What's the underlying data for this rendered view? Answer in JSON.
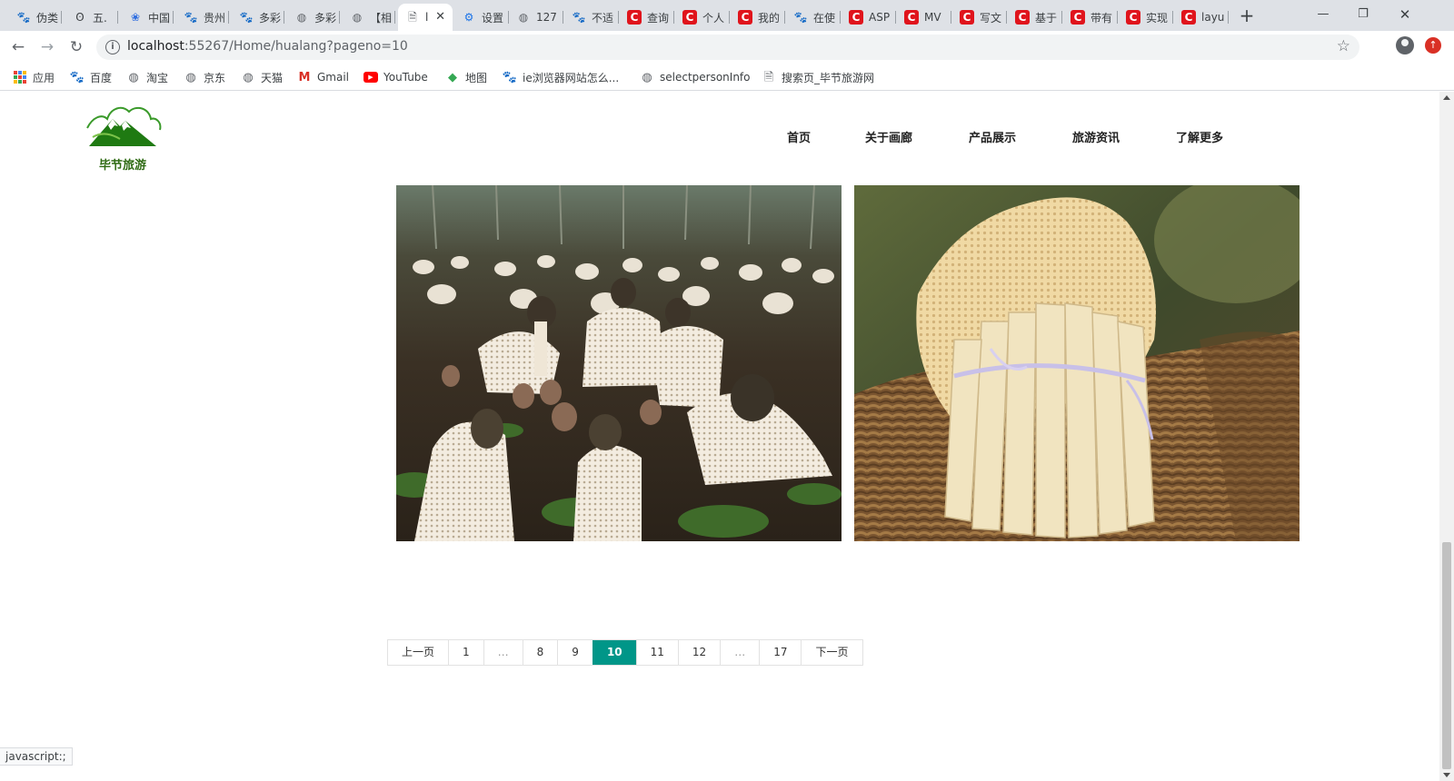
{
  "browser": {
    "tabs": [
      {
        "title": "伪类",
        "favicon": "paw-icon"
      },
      {
        "title": "五.",
        "favicon": "fan-icon"
      },
      {
        "title": "中国",
        "favicon": "paw-outline-icon"
      },
      {
        "title": "贵州",
        "favicon": "paw-icon"
      },
      {
        "title": "多彩",
        "favicon": "paw-icon"
      },
      {
        "title": "多彩",
        "favicon": "globe-icon"
      },
      {
        "title": "【相",
        "favicon": "globe-icon"
      },
      {
        "title": "l",
        "favicon": "page-icon",
        "active": true
      },
      {
        "title": "设置",
        "favicon": "gear-icon"
      },
      {
        "title": "127",
        "favicon": "globe-icon"
      },
      {
        "title": "不适",
        "favicon": "paw-icon"
      },
      {
        "title": "查询",
        "favicon": "csdn-icon"
      },
      {
        "title": "个人",
        "favicon": "csdn-icon"
      },
      {
        "title": "我的",
        "favicon": "csdn-icon"
      },
      {
        "title": "在使",
        "favicon": "paw-icon"
      },
      {
        "title": "ASP",
        "favicon": "csdn-icon"
      },
      {
        "title": "MV",
        "favicon": "csdn-icon"
      },
      {
        "title": "写文",
        "favicon": "csdn-icon"
      },
      {
        "title": "基于",
        "favicon": "csdn-icon"
      },
      {
        "title": "带有",
        "favicon": "csdn-icon"
      },
      {
        "title": "实现",
        "favicon": "csdn-icon"
      },
      {
        "title": "layu",
        "favicon": "csdn-icon"
      }
    ],
    "address": {
      "host": "localhost",
      "rest": ":55267/Home/hualang?pageno=10"
    },
    "bookmarks": [
      {
        "label": "应用",
        "icon": "apps-icon"
      },
      {
        "label": "百度",
        "icon": "paw-icon"
      },
      {
        "label": "淘宝",
        "icon": "globe-icon"
      },
      {
        "label": "京东",
        "icon": "globe-icon"
      },
      {
        "label": "天猫",
        "icon": "globe-icon"
      },
      {
        "label": "Gmail",
        "icon": "gmail-icon"
      },
      {
        "label": "YouTube",
        "icon": "youtube-icon"
      },
      {
        "label": "地图",
        "icon": "maps-icon"
      },
      {
        "label": "ie浏览器网站怎么...",
        "icon": "paw-icon"
      },
      {
        "label": "selectpersonInfo",
        "icon": "globe-icon"
      },
      {
        "label": "搜索页_毕节旅游网",
        "icon": "document-icon"
      }
    ],
    "status_text": "javascript:;"
  },
  "site": {
    "logo_text": "毕节旅游",
    "nav": [
      "首页",
      "关于画廊",
      "产品展示",
      "旅游资讯",
      "了解更多"
    ],
    "photos": [
      {
        "name": "bamboo-fungus-field-photo"
      },
      {
        "name": "bamboo-fungus-basket-photo"
      }
    ],
    "pagination": {
      "prev": "上一页",
      "next": "下一页",
      "pages": [
        "1",
        "…",
        "8",
        "9",
        "10",
        "11",
        "12",
        "…",
        "17"
      ],
      "current": "10",
      "accent_color": "#009688"
    }
  }
}
